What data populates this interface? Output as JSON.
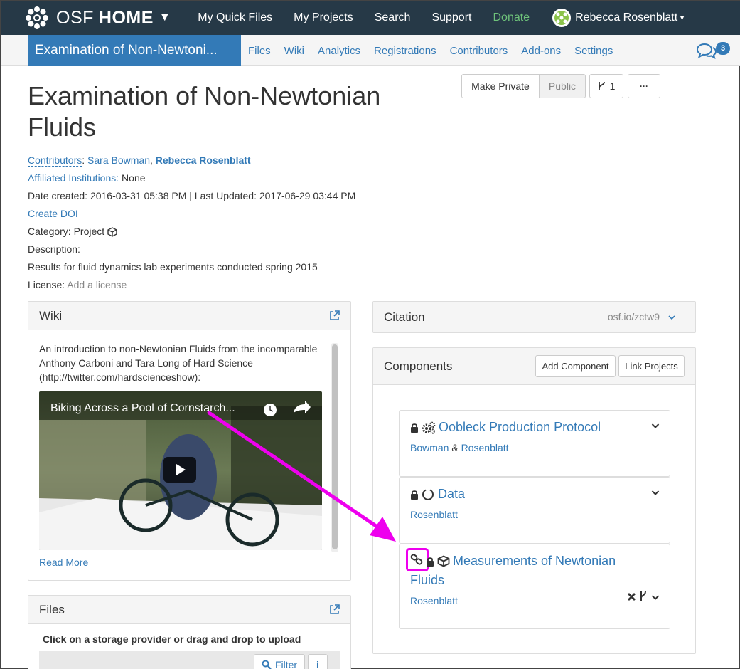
{
  "topnav": {
    "brand_osf": "OSF",
    "brand_home": "HOME",
    "links": [
      "My Quick Files",
      "My Projects",
      "Search",
      "Support",
      "Donate"
    ],
    "user_name": "Rebecca Rosenblatt"
  },
  "projnav": {
    "title": "Examination of Non-Newtoni...",
    "links": [
      "Files",
      "Wiki",
      "Analytics",
      "Registrations",
      "Contributors",
      "Add-ons",
      "Settings"
    ],
    "comment_count": "3"
  },
  "actions": {
    "make_private": "Make Private",
    "public": "Public",
    "fork_count": "1",
    "more": "···"
  },
  "project": {
    "title": "Examination of Non-Newtonian Fluids",
    "contributors_label": "Contributors",
    "contributor_1": "Sara Bowman",
    "contributor_2": "Rebecca Rosenblatt",
    "affiliated_label": "Affiliated Institutions:",
    "affiliated_value": "None",
    "dates": "Date created: 2016-03-31 05:38 PM | Last Updated: 2017-06-29 03:44 PM",
    "create_doi": "Create DOI",
    "category_label": "Category: Project",
    "description_label": "Description:",
    "description": "Results for fluid dynamics lab experiments conducted spring 2015",
    "license_label": "License:",
    "license_value": "Add a license"
  },
  "wiki": {
    "heading": "Wiki",
    "text": "An introduction to non-Newtonian Fluids from the incomparable Anthony Carboni and Tara Long of Hard Science (http://twitter.com/hardscienceshow):",
    "video_title": "Biking Across a Pool of Cornstarch...",
    "read_more": "Read More"
  },
  "files": {
    "heading": "Files",
    "instructions": "Click on a storage provider or drag and drop to upload",
    "filter": "Filter"
  },
  "citation": {
    "heading": "Citation",
    "link": "osf.io/zctw9"
  },
  "components": {
    "heading": "Components",
    "add_button": "Add Component",
    "link_button": "Link Projects",
    "items": [
      {
        "title": "Oobleck Production Protocol",
        "contrib_1": "Bowman",
        "amp": "&",
        "contrib_2": "Rosenblatt"
      },
      {
        "title": "Data",
        "contrib_1": "Rosenblatt"
      },
      {
        "title_line1": "Measurements of Newtonian",
        "title_line2": "Fluids",
        "contrib_1": "Rosenblatt"
      }
    ]
  },
  "colors": {
    "navbar": "#263947",
    "accent": "#337ab7",
    "donate": "#6ec27a",
    "annotation": "#ee00ee"
  }
}
